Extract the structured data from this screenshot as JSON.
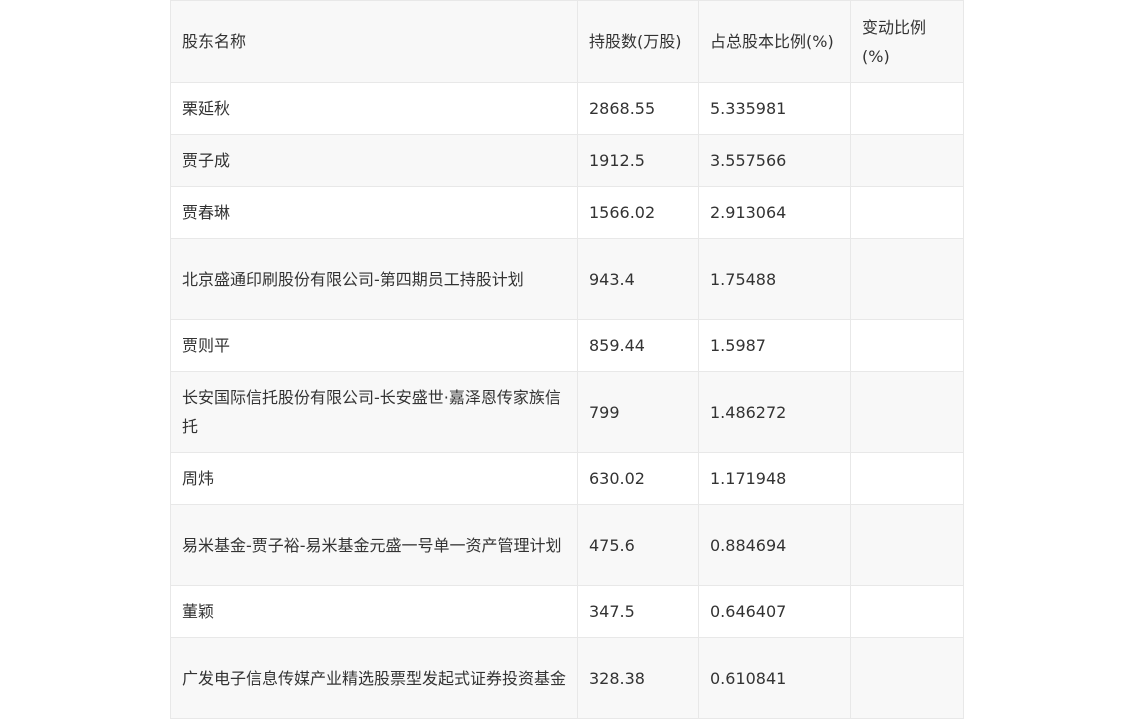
{
  "table": {
    "headers": [
      "股东名称",
      "持股数(万股)",
      "占总股本比例(%)",
      "变动比例(%)"
    ],
    "rows": [
      {
        "name": "栗延秋",
        "shares": "2868.55",
        "ratio": "5.335981",
        "change": ""
      },
      {
        "name": "贾子成",
        "shares": "1912.5",
        "ratio": "3.557566",
        "change": ""
      },
      {
        "name": "贾春琳",
        "shares": "1566.02",
        "ratio": "2.913064",
        "change": ""
      },
      {
        "name": "北京盛通印刷股份有限公司-第四期员工持股计划",
        "shares": "943.4",
        "ratio": "1.75488",
        "change": ""
      },
      {
        "name": "贾则平",
        "shares": "859.44",
        "ratio": "1.5987",
        "change": ""
      },
      {
        "name": "长安国际信托股份有限公司-长安盛世·嘉泽恩传家族信托",
        "shares": "799",
        "ratio": "1.486272",
        "change": ""
      },
      {
        "name": "周炜",
        "shares": "630.02",
        "ratio": "1.171948",
        "change": ""
      },
      {
        "name": "易米基金-贾子裕-易米基金元盛一号单一资产管理计划",
        "shares": "475.6",
        "ratio": "0.884694",
        "change": ""
      },
      {
        "name": "董颖",
        "shares": "347.5",
        "ratio": "0.646407",
        "change": ""
      },
      {
        "name": "广发电子信息传媒产业精选股票型发起式证券投资基金",
        "shares": "328.38",
        "ratio": "0.610841",
        "change": ""
      }
    ]
  }
}
